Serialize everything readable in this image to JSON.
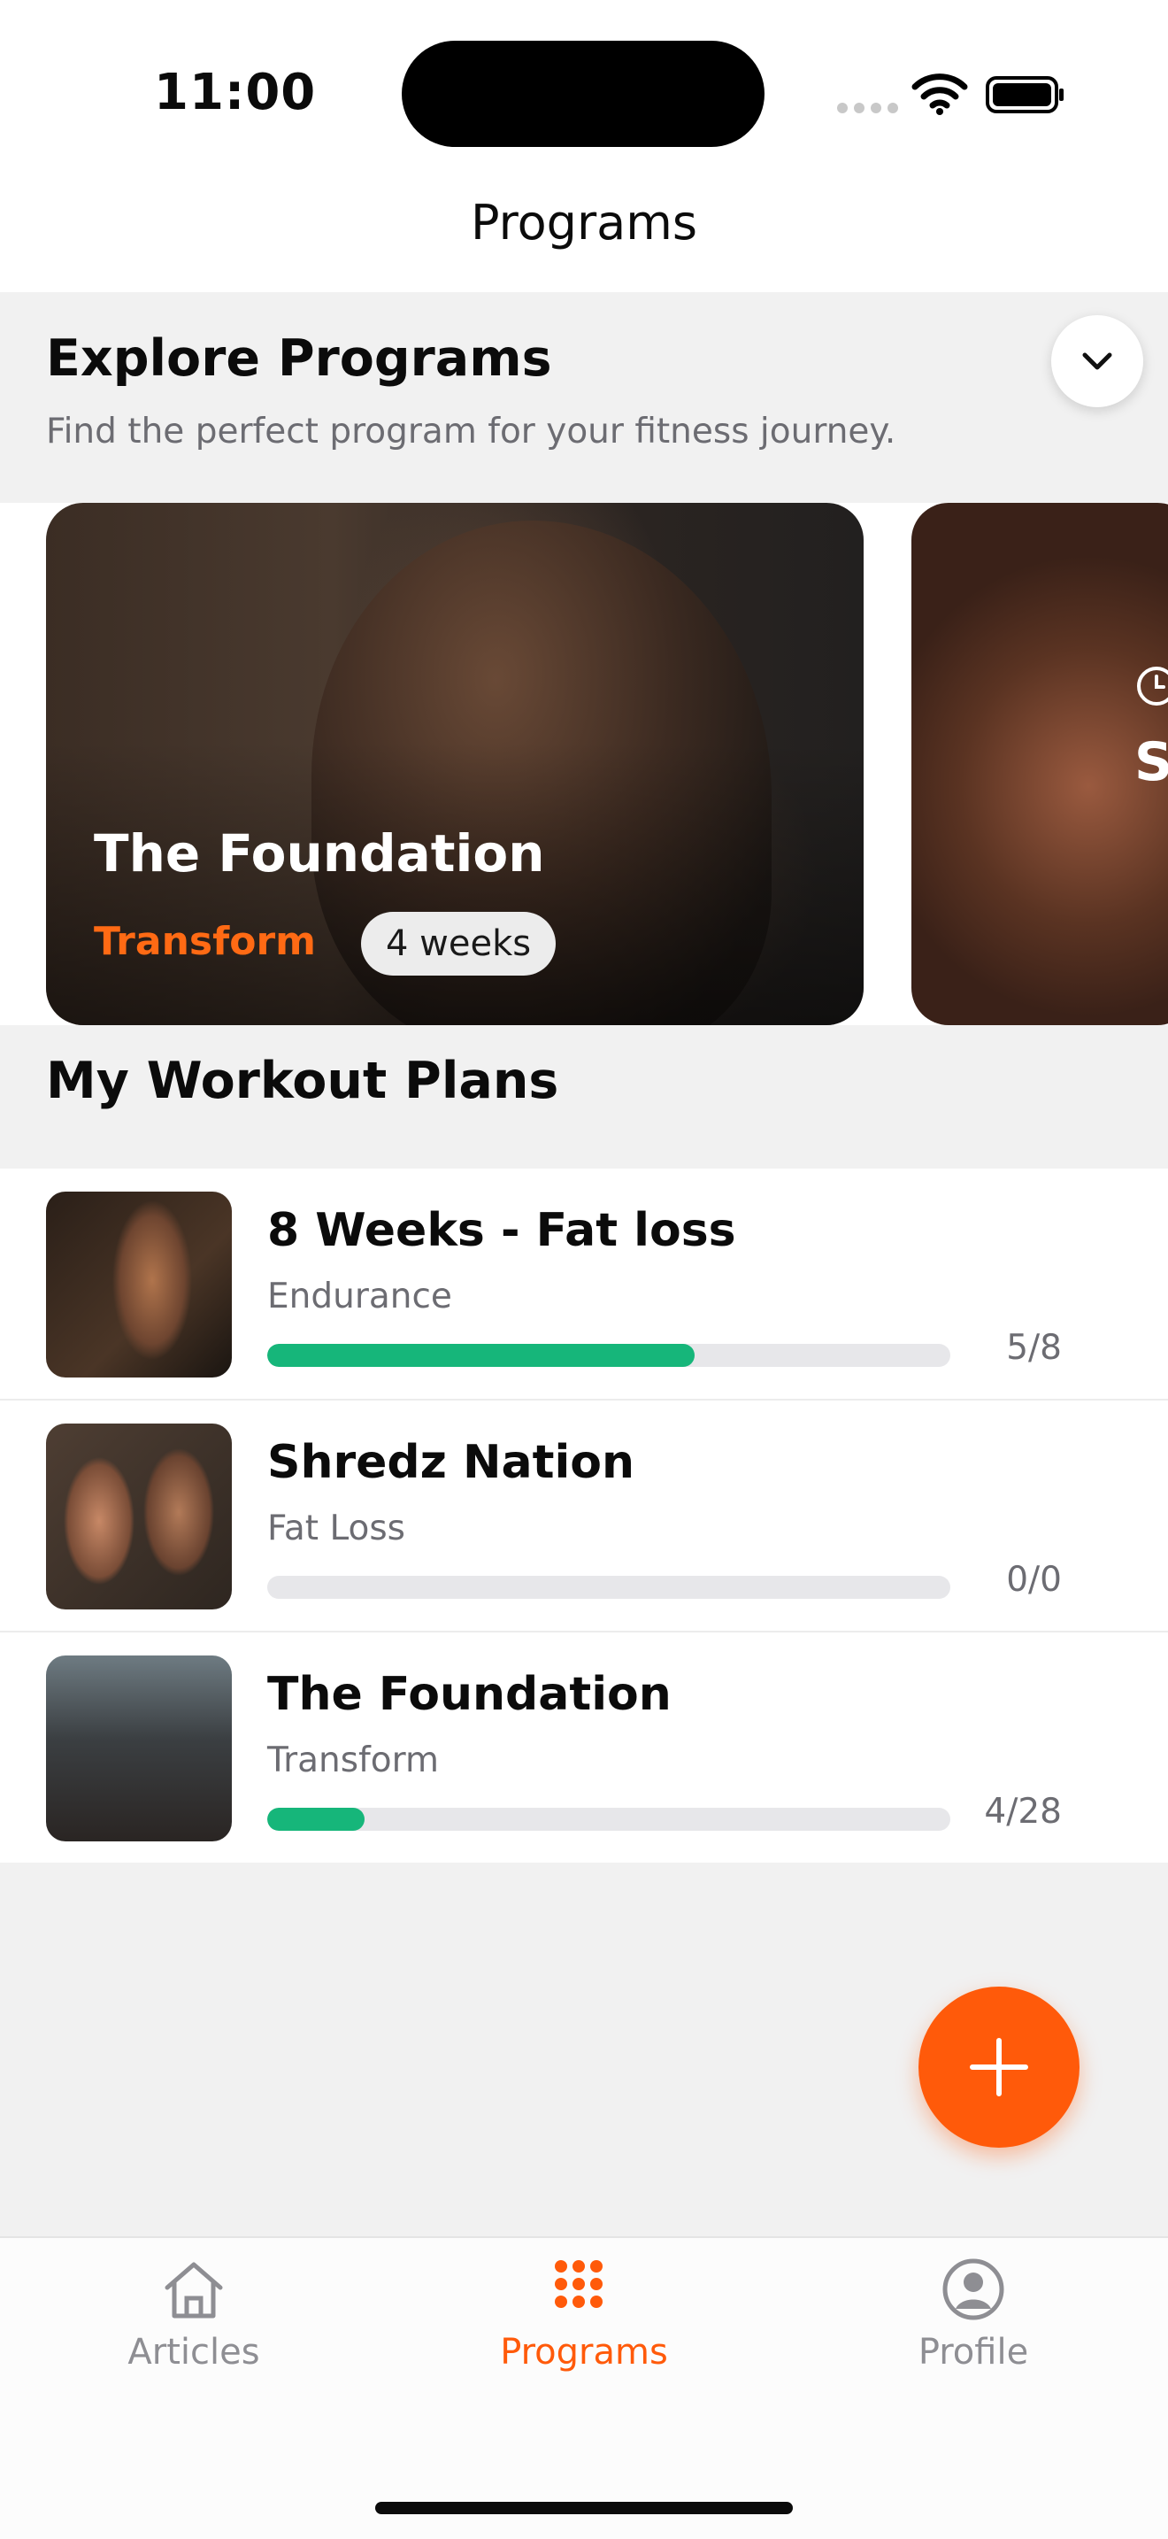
{
  "status_bar": {
    "time": "11:00"
  },
  "nav": {
    "title": "Programs"
  },
  "explore": {
    "title": "Explore Programs",
    "subtitle": "Find the perfect program for your fitness journey."
  },
  "featured": [
    {
      "title": "The Foundation",
      "category": "Transform",
      "duration": "4 weeks"
    },
    {
      "title_visible": "S"
    }
  ],
  "plans_section": {
    "title": "My Workout Plans"
  },
  "plans": [
    {
      "name": "8 Weeks - Fat loss",
      "category": "Endurance",
      "progress_text": "5/8",
      "progress": 0.625
    },
    {
      "name": "Shredz Nation",
      "category": "Fat Loss",
      "progress_text": "0/0",
      "progress": 0
    },
    {
      "name": "The Foundation",
      "category": "Transform",
      "progress_text": "4/28",
      "progress": 0.143
    }
  ],
  "tabbar": {
    "items": [
      {
        "label": "Articles",
        "icon": "home-icon",
        "active": false
      },
      {
        "label": "Programs",
        "icon": "grid-icon",
        "active": true
      },
      {
        "label": "Profile",
        "icon": "profile-icon",
        "active": false
      }
    ]
  },
  "colors": {
    "accent": "#ff5a0a",
    "progress": "#16b67a",
    "inactive_tab": "#8e8e93"
  }
}
